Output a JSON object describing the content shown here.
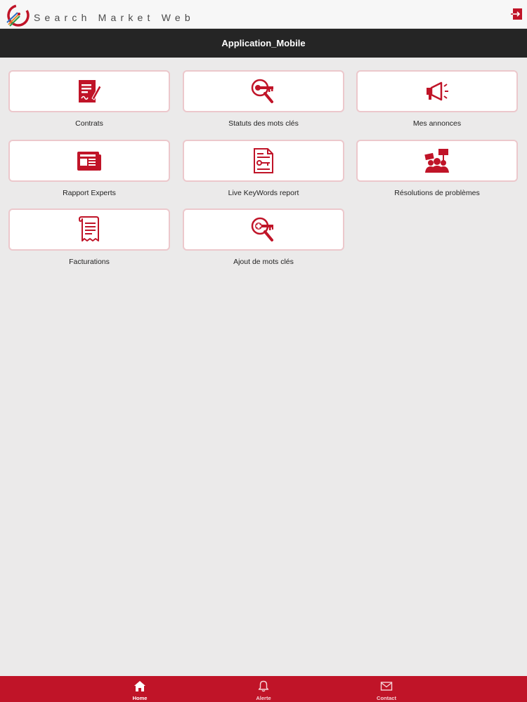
{
  "header": {
    "brand": "Search Market Web",
    "title": "Application_Mobile"
  },
  "tiles": [
    {
      "label": "Contrats",
      "icon": "contract-icon"
    },
    {
      "label": "Statuts des mots clés",
      "icon": "key-search-icon"
    },
    {
      "label": "Mes annonces",
      "icon": "megaphone-icon"
    },
    {
      "label": "Rapport Experts",
      "icon": "newspaper-icon"
    },
    {
      "label": "Live KeyWords report",
      "icon": "key-document-icon"
    },
    {
      "label": "Résolutions de problèmes",
      "icon": "protest-group-icon"
    },
    {
      "label": "Facturations",
      "icon": "invoice-scroll-icon"
    },
    {
      "label": "Ajout de mots clés",
      "icon": "add-keyword-icon"
    }
  ],
  "nav": {
    "home": "Home",
    "alerts": "Alerte",
    "contact": "Contact"
  },
  "colors": {
    "accent": "#c01428",
    "header_dark": "#252525",
    "background": "#ebeaea",
    "tile_border": "#ecc8cc"
  }
}
